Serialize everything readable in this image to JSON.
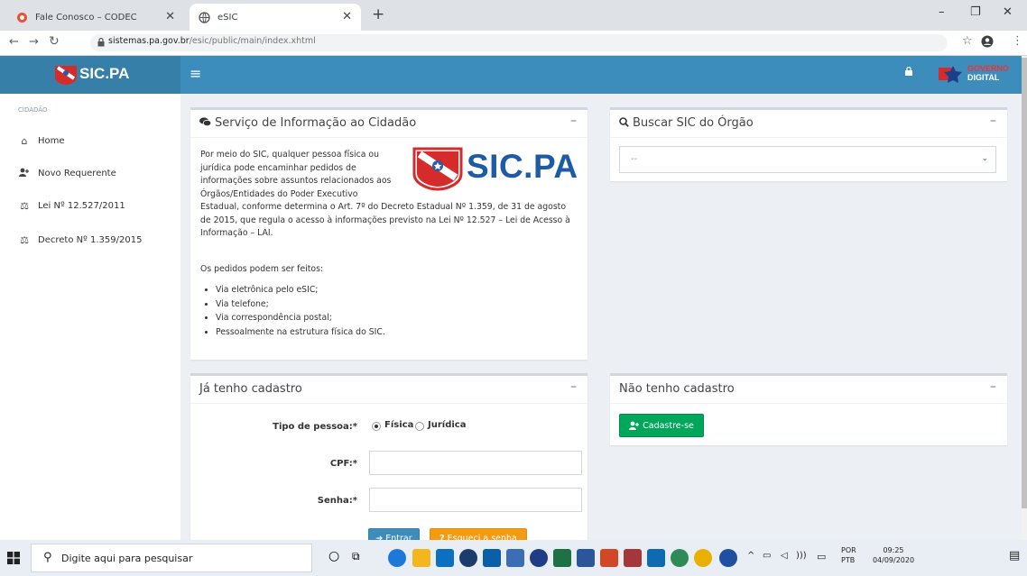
{
  "browser": {
    "tabs": [
      {
        "label": "Fale Conosco – CODEC",
        "active": false
      },
      {
        "label": "eSIC",
        "active": true
      }
    ],
    "new_tab": "+",
    "url_host": "sistemas.pa.gov.br",
    "url_path": "/esic/public/main/index.xhtml"
  },
  "header": {
    "brand": "SIC.PA",
    "gov_logo_line1": "GOVERNO",
    "gov_logo_line2": "DIGITAL"
  },
  "sidebar": {
    "section": "CIDADÃO",
    "items": [
      {
        "label": "Home",
        "icon": "home-icon"
      },
      {
        "label": "Novo Requerente",
        "icon": "user-plus-icon"
      },
      {
        "label": "Lei Nº 12.527/2011",
        "icon": "scale-icon"
      },
      {
        "label": "Decreto Nº 1.359/2015",
        "icon": "scale-icon"
      }
    ]
  },
  "info_box": {
    "title": "Serviço de Informação ao Cidadão",
    "logo_text": "SIC.PA",
    "para_lines": [
      "Por meio do SIC, qualquer pessoa física ou",
      "jurídica pode encaminhar pedidos de",
      "informações sobre assuntos relacionados aos",
      "Órgãos/Entidades do Poder Executivo",
      "Estadual, conforme determina o Art. 7º do Decreto Estadual Nº 1.359, de 31 de agosto",
      "de 2015, que regula o acesso à informações previsto na Lei Nº 12.527 – Lei de Acesso à",
      "Informação – LAI."
    ],
    "subhead": "Os pedidos podem ser feitos:",
    "bullets": [
      "Via eletrônica pelo eSIC;",
      "Via telefone;",
      "Via correspondência postal;",
      "Pessoalmente na estrutura física do SIC."
    ]
  },
  "search_box": {
    "title": "Buscar SIC do Órgão",
    "select_value": "--"
  },
  "login_box": {
    "title": "Já tenho cadastro",
    "tipo_label": "Tipo de pessoa:*",
    "radio_fisica": "Física",
    "radio_juridica": "Jurídica",
    "cpf_label": "CPF:*",
    "senha_label": "Senha:*",
    "enter_button": "Entrar",
    "forgot_button": "Esqueci a senha"
  },
  "register_box": {
    "title": "Não tenho cadastro",
    "button": "Cadastre-se"
  },
  "taskbar": {
    "search_placeholder": "Digite aqui para pesquisar",
    "lang_line1": "POR",
    "lang_line2": "PTB",
    "time": "09:25",
    "date": "04/09/2020"
  },
  "colors": {
    "header_blue": "#3c8dbc",
    "brand_blue": "#367fa9",
    "success_green": "#00a65a",
    "warning_orange": "#f39c12"
  }
}
